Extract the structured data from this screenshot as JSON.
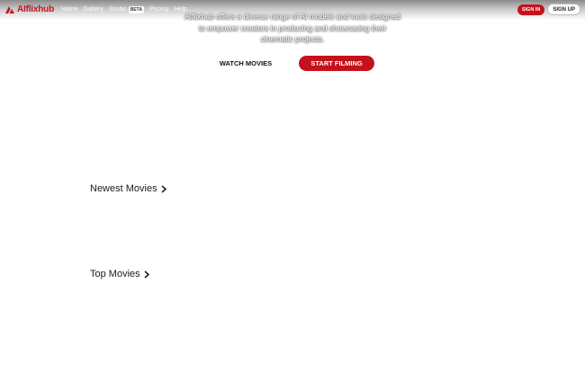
{
  "header": {
    "logo_text": "AIflixhub",
    "nav_links": [
      "Home",
      "Gallery",
      "Studio",
      "Pricing",
      "Help"
    ],
    "beta_badge": "BETA",
    "signin_label": "SIGN IN",
    "signup_label": "SIGN UP"
  },
  "hero": {
    "lines": [
      "AIflixhub offers a diverse range of AI models and tools designed",
      "to empower creators in producing and showcasing their",
      "cinematic projects."
    ],
    "watch_label": "WATCH MOVIES",
    "start_label": "START FILMING"
  },
  "sections": {
    "newest_title": "Newest Movies",
    "top_title": "Top Movies"
  },
  "colors": {
    "brand_red": "#c4121c"
  },
  "icons": {
    "logo": "aiflixhub-logo-icon",
    "section_arrow": "chevron-right-icon"
  }
}
